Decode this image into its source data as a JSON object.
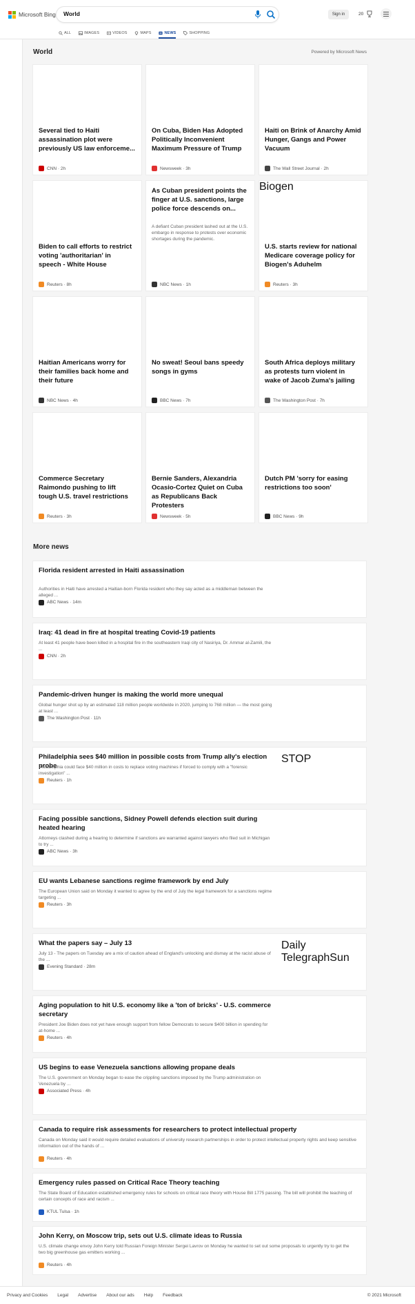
{
  "header": {
    "logo_text": "Microsoft Bing",
    "query": "World",
    "signin": "Sign in",
    "rewards_count": "20"
  },
  "nav": [
    {
      "label": "ALL",
      "icon": "search-icon"
    },
    {
      "label": "IMAGES",
      "icon": "image-icon"
    },
    {
      "label": "VIDEOS",
      "icon": "video-icon"
    },
    {
      "label": "MAPS",
      "icon": "map-pin-icon"
    },
    {
      "label": "NEWS",
      "icon": "news-icon",
      "active": true
    },
    {
      "label": "SHOPPING",
      "icon": "tag-icon"
    }
  ],
  "rail_icons": [
    "expand-arrow-icon",
    "home-icon",
    "discover-icon",
    "flag-icon",
    "location-pin-icon",
    "globe-icon",
    "scale-icon",
    "rocket-icon",
    "film-icon",
    "bank-icon",
    "card-icon"
  ],
  "section": {
    "title": "World",
    "powered_by": "Powered by Microsoft News"
  },
  "cards": [
    {
      "title": "Several tied to Haiti assassination plot were previously US law enforceme...",
      "source": "CNN",
      "time": "2h",
      "logo_color": "#cc0000",
      "img": "haiti-president"
    },
    {
      "title": "On Cuba, Biden Has Adopted Politically Inconvenient Maximum Pressure of Trump",
      "source": "Newsweek",
      "time": "3h",
      "logo_color": "#e03030",
      "img": "cuba-flag"
    },
    {
      "title": "Haiti on Brink of Anarchy Amid Hunger, Gangs and Power Vacuum",
      "source": "The Wall Street Journal",
      "time": "2h",
      "logo_color": "#444444",
      "img": "protest"
    },
    {
      "title": "Biden to call efforts to restrict voting 'authoritarian' in speech - White House",
      "source": "Reuters",
      "time": "8h",
      "logo_color": "#f08a24",
      "img": "biden-night"
    },
    {
      "title": "As Cuban president points the finger at U.S. sanctions, large police force descends on...",
      "snippet": "A defiant Cuban president lashed out at the U.S. embargo in response to protests over economic shortages during the pandemic.",
      "source": "NBC News",
      "time": "1h",
      "logo_color": "#333333",
      "img": ""
    },
    {
      "title": "U.S. starts review for national Medicare coverage policy for Biogen's Aduhelm",
      "source": "Reuters",
      "time": "3h",
      "logo_color": "#f08a24",
      "img": "biogen",
      "img_text": "Biogen"
    },
    {
      "title": "Haitian Americans worry for their families back home and their future",
      "source": "NBC News",
      "time": "4h",
      "logo_color": "#333333",
      "img": "crowd"
    },
    {
      "title": "No sweat! Seoul bans speedy songs in gyms",
      "source": "BBC News",
      "time": "7h",
      "logo_color": "#222222",
      "img": "gym"
    },
    {
      "title": "South Africa deploys military as protests turn violent in wake of Jacob Zuma's jailing",
      "source": "The Washington Post",
      "time": "7h",
      "logo_color": "#555555",
      "img": "street"
    },
    {
      "title": "Commerce Secretary Raimondo pushing to lift tough U.S. travel restrictions",
      "source": "Reuters",
      "time": "3h",
      "logo_color": "#f08a24",
      "img": "airport-board"
    },
    {
      "title": "Bernie Sanders, Alexandria Ocasio-Cortez Quiet on Cuba as Republicans Back Protesters",
      "source": "Newsweek",
      "time": "5h",
      "logo_color": "#e03030",
      "img": "havana"
    },
    {
      "title": "Dutch PM 'sorry for easing restrictions too soon'",
      "source": "BBC News",
      "time": "9h",
      "logo_color": "#222222",
      "img": "night-crowd"
    }
  ],
  "more": {
    "title": "More news",
    "items": [
      {
        "title": "Florida resident arrested in Haiti assassination",
        "snippet": "Authorities in Haiti have arrested a Haitian-born Florida resident who they say acted as a middleman between the alleged ...",
        "source": "ABC News",
        "time": "14m",
        "logo_color": "#222222",
        "img": "officials"
      },
      {
        "title": "Iraq: 41 dead in fire at hospital treating Covid-19 patients",
        "snippet": "At least 41 people have been killed in a hospital fire in the southeastern Iraqi city of Nasiriya, Dr. Ammar al-Zamili, the ...",
        "source": "CNN",
        "time": "2h",
        "logo_color": "#cc0000",
        "img": "fire"
      },
      {
        "title": "Pandemic-driven hunger is making the world more unequal",
        "snippet": "Global hunger shot up by an estimated 118 million people worldwide in 2020, jumping to 768 million — the most going at least ...",
        "source": "The Washington Post",
        "time": "11h",
        "logo_color": "#555555",
        "img": "dark-door"
      },
      {
        "title": "Philadelphia sees $40 million in possible costs from Trump ally's election probe",
        "snippet": "Philadelphia could face $40 million in costs to replace voting machines if forced to comply with a \"forensic investigation\" ...",
        "source": "Reuters",
        "time": "1h",
        "logo_color": "#f08a24",
        "img": "capitol-night"
      },
      {
        "title": "Facing possible sanctions, Sidney Powell defends election suit during heated hearing",
        "snippet": "Attorneys clashed during a hearing to determine if sanctions are warranted against lawyers who filed suit in Michigan to try ...",
        "source": "ABC News",
        "time": "3h",
        "logo_color": "#222222",
        "img": "powell"
      },
      {
        "title": "EU wants Lebanese sanctions regime framework by end July",
        "snippet": "The European Union said on Monday it wanted to agree by the end of July the legal framework for a sanctions regime targeting ...",
        "source": "Reuters",
        "time": "3h",
        "logo_color": "#f08a24",
        "img": "eu-man"
      },
      {
        "title": "What the papers say – July 13",
        "snippet": "July 13 - The papers on Tuesday are a mix of caution ahead of England's unlocking and dismay at the racist abuse of the ...",
        "source": "Evening Standard",
        "time": "28m",
        "logo_color": "#333333",
        "img": "papers"
      },
      {
        "title": "Aging population to hit U.S. economy like a 'ton of bricks' - U.S. commerce secretary",
        "snippet": "President Joe Biden does not yet have enough support from fellow Democrats to secure $400 billion in spending for at-home ...",
        "source": "Reuters",
        "time": "4h",
        "logo_color": "#f08a24",
        "img": "raimondo"
      },
      {
        "title": "US begins to ease Venezuela sanctions allowing propane deals",
        "snippet": "The U.S. government on Monday began to ease the crippling sanctions imposed by the Trump administration on Venezuela by ...",
        "source": "Associated Press",
        "time": "4h",
        "logo_color": "#cc0000",
        "img": "venezuela"
      },
      {
        "title": "Canada to require risk assessments for researchers to protect intellectual property",
        "snippet": "Canada on Monday said it would require detailed evaluations of university research partnerships in order to protect intellectual property rights and keep sensitive information out of the hands of ...",
        "source": "Reuters",
        "time": "4h",
        "logo_color": "#f08a24",
        "img": ""
      },
      {
        "title": "Emergency rules passed on Critical Race Theory teaching",
        "snippet": "The State Board of Education established emergency rules for schools on critical race theory with House Bill 1775 passing. The bill will prohibit the teaching of certain concepts of race and racism ...",
        "source": "KTUL Tulsa",
        "time": "1h",
        "logo_color": "#1f5bbf",
        "img": ""
      },
      {
        "title": "John Kerry, on Moscow trip, sets out U.S. climate ideas to Russia",
        "snippet": "U.S. climate change envoy John Kerry told Russian Foreign Minister Sergei Lavrov on Monday he wanted to set out some proposals to urgently try to get the two big greenhouse gas emitters working ...",
        "source": "Reuters",
        "time": "4h",
        "logo_color": "#f08a24",
        "img": ""
      }
    ]
  },
  "footer": {
    "links": [
      "Privacy and Cookies",
      "Legal",
      "Advertise",
      "About our ads",
      "Help",
      "Feedback"
    ],
    "copyright": "© 2021 Microsoft"
  },
  "colors": {
    "accent": "#1a4a9c",
    "search_blue": "#0a72c9"
  }
}
